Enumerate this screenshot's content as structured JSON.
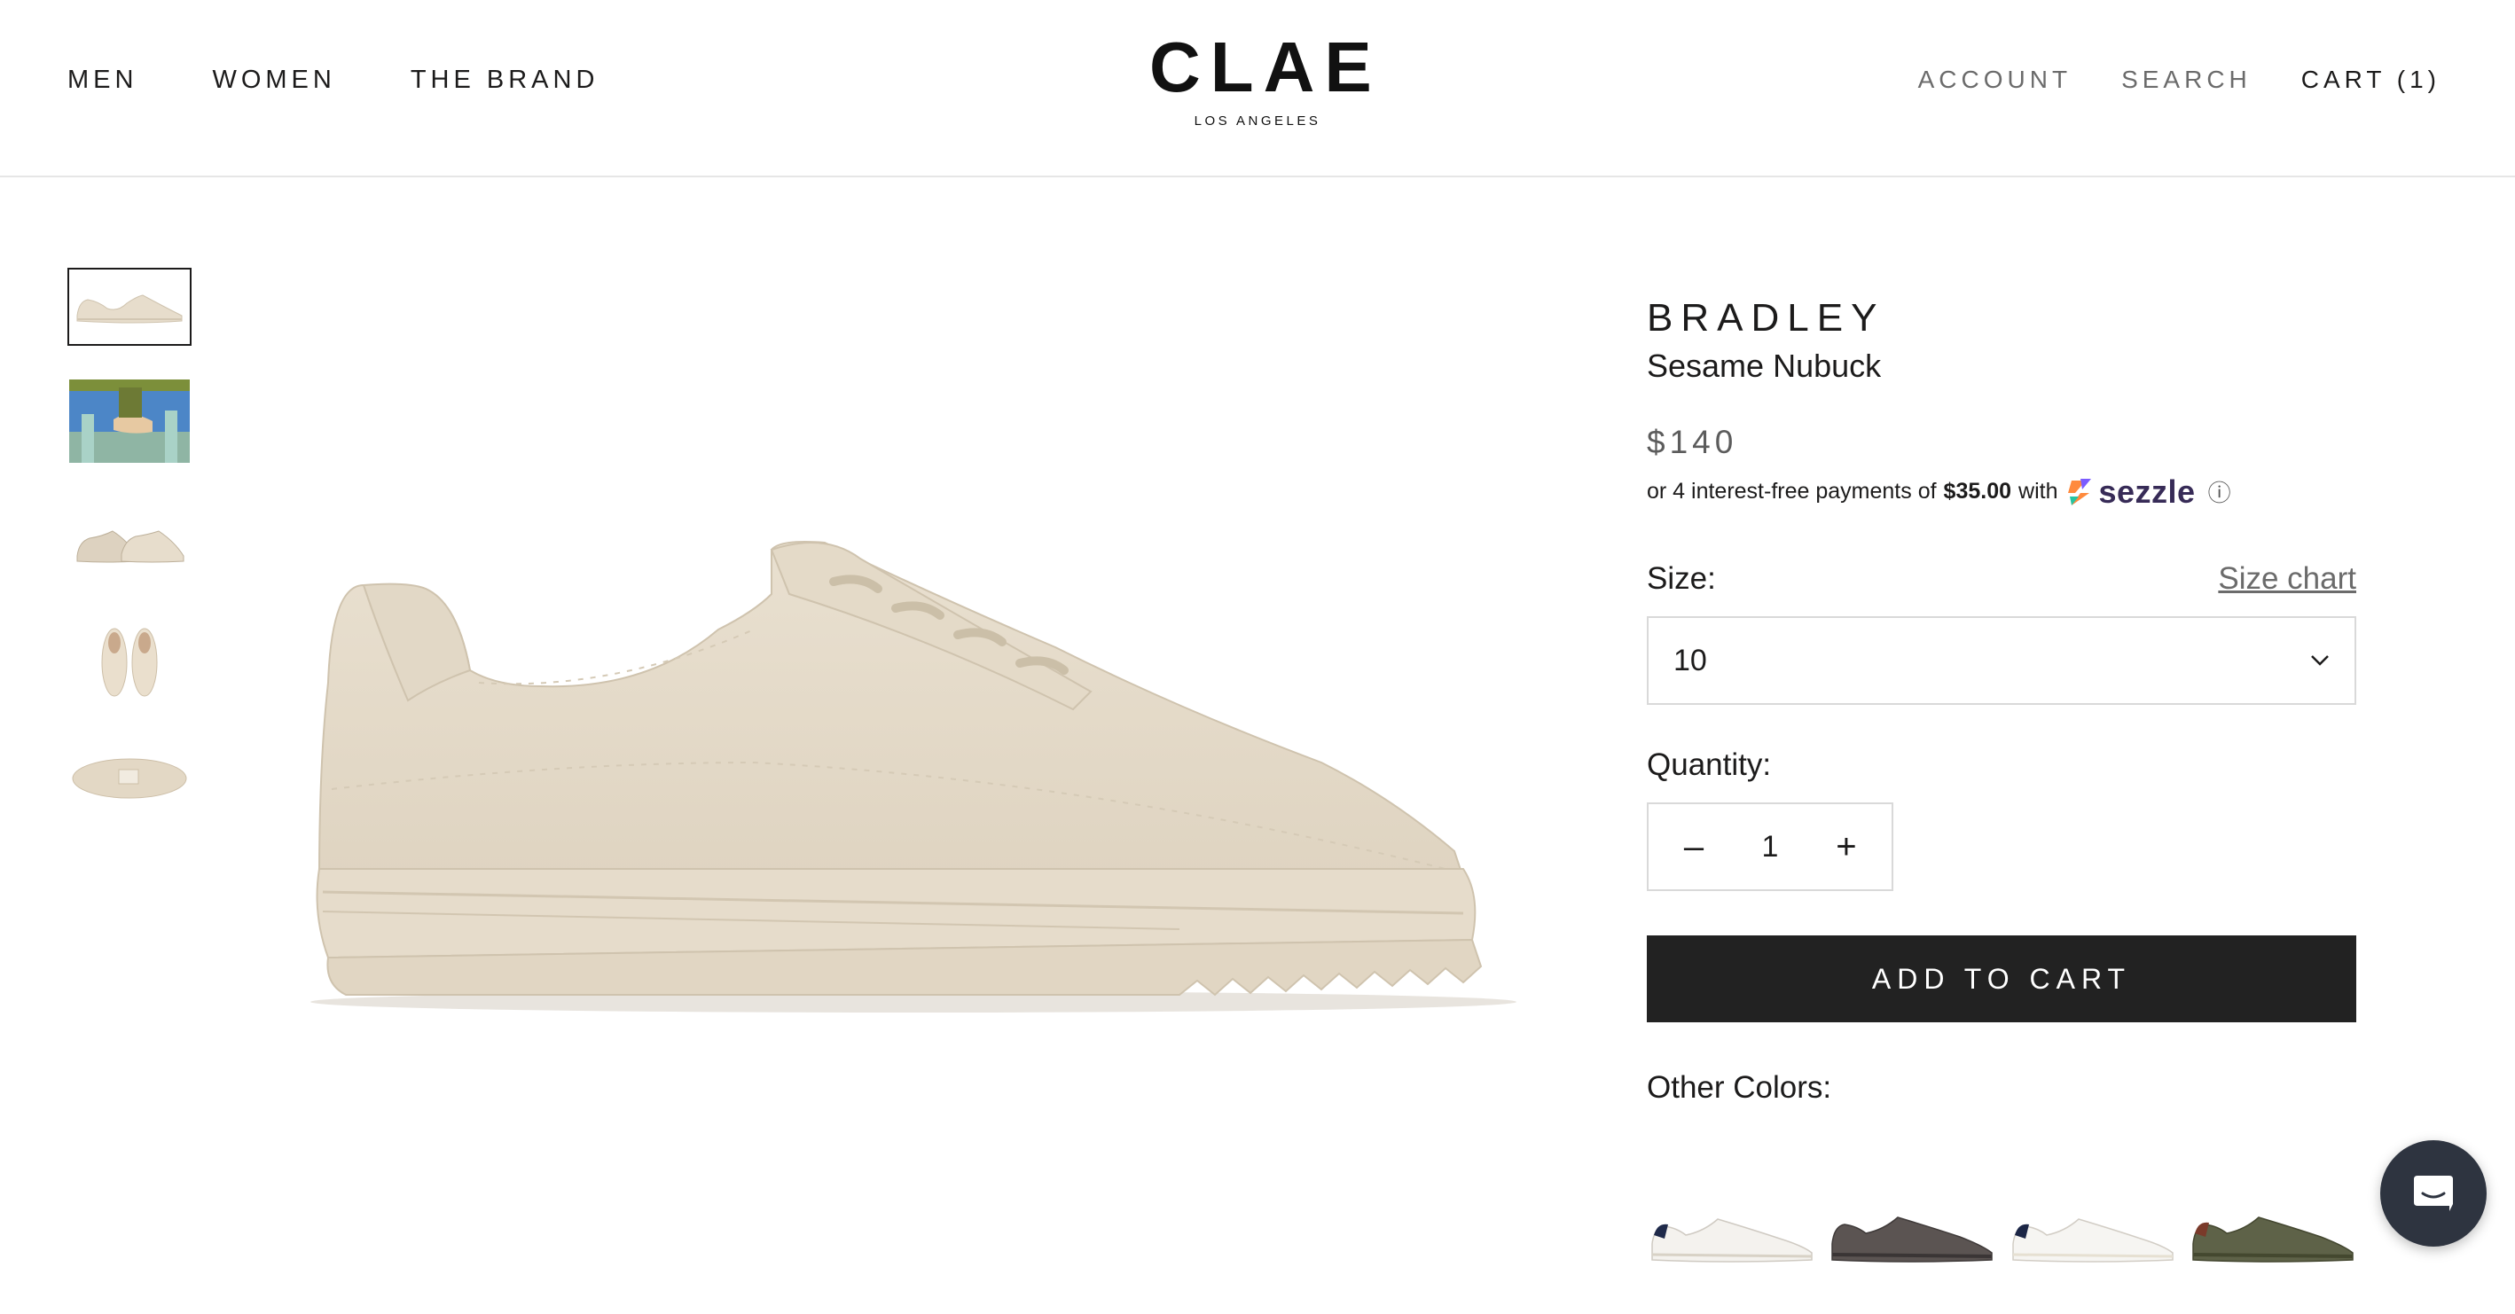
{
  "header": {
    "nav_left": [
      "MEN",
      "WOMEN",
      "THE BRAND"
    ],
    "logo_main": "CLAE",
    "logo_sub": "LOS ANGELES",
    "account": "ACCOUNT",
    "search": "SEARCH",
    "cart": "CART (1)"
  },
  "gallery": {
    "thumbnails": [
      "side-view",
      "lifestyle",
      "pair-view",
      "top-view",
      "sole-view"
    ],
    "active_thumbnail": 0
  },
  "product": {
    "name": "BRADLEY",
    "color": "Sesame Nubuck",
    "price": "$140",
    "sezzle_prefix": "or 4 interest-free payments of",
    "sezzle_amount": "$35.00",
    "sezzle_with": "with",
    "sezzle_brand": "sezzle",
    "sezzle_info": "ⓘ",
    "size_label": "Size:",
    "size_chart": "Size chart",
    "size_value": "10",
    "quantity_label": "Quantity:",
    "quantity_value": "1",
    "minus": "–",
    "plus": "+",
    "add_to_cart": "ADD TO CART",
    "other_colors_label": "Other Colors:"
  },
  "other_colors": [
    "white-navy",
    "charcoal",
    "white-navy-2",
    "olive"
  ],
  "colors": {
    "shoe": "#e7ddcc",
    "shoe_shadow": "#d3c7b3",
    "button_bg": "#222222",
    "chat_bg": "#2e3440",
    "sezzle": "#372b57"
  }
}
